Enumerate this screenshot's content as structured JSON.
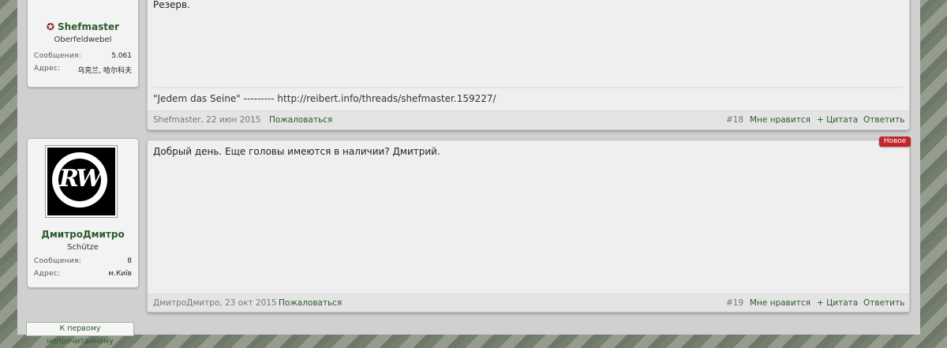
{
  "posts": [
    {
      "username": "Shefmaster",
      "user_title": "Oberfeldwebel",
      "messages_label": "Сообщения:",
      "messages_value": "5.061",
      "address_label": "Адрес:",
      "address_value": "乌克兰, 哈尔科夫",
      "text": "Резерв.",
      "signature": "\"Jedem das Seine\" --------- http://reibert.info/threads/shefmaster.159227/",
      "author_date": "Shefmaster, 22 июн 2015",
      "report": "Пожаловаться",
      "post_number": "#18",
      "like": "Мне нравится",
      "quote": "+ Цитата",
      "reply": "Ответить"
    },
    {
      "username": "ДмитроДмитро",
      "user_title": "Schütze",
      "messages_label": "Сообщения:",
      "messages_value": "8",
      "address_label": "Адрес:",
      "address_value": "м.Київ",
      "text": "Добрый день. Еще головы имеются в наличии? Дмитрий.",
      "badge": "Новое",
      "author_date": "ДмитроДмитро, 23 окт 2015",
      "report": "Пожаловаться",
      "post_number": "#19",
      "like": "Мне нравится",
      "quote": "+ Цитата",
      "reply": "Ответить"
    }
  ],
  "avatar2_text": "RW",
  "unread_button": "К первому непрочитанному"
}
